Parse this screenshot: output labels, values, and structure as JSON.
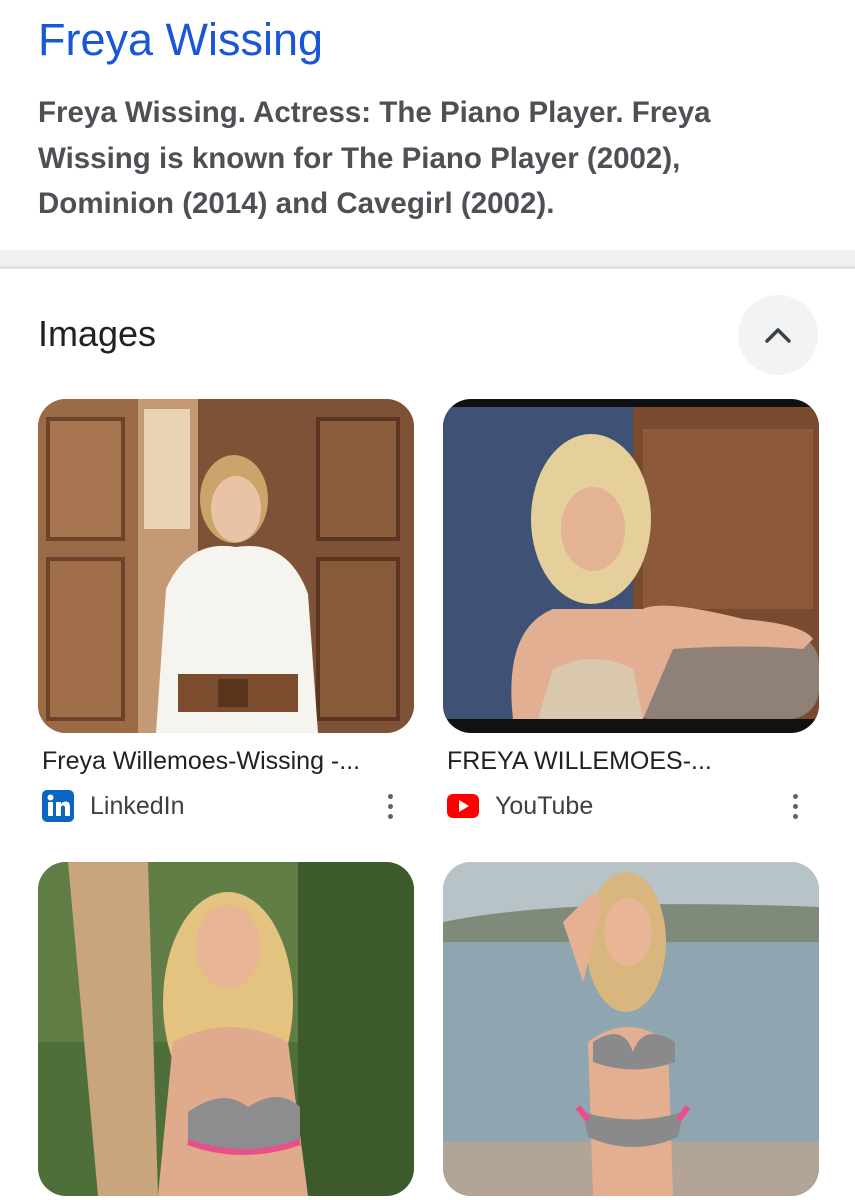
{
  "result": {
    "title": "Freya Wissing",
    "snippet": "Freya Wissing. Actress: The Piano Player. Freya Wissing is known for The Piano Player (2002), Dominion (2014) and Cavegirl (2002)."
  },
  "images_section": {
    "heading": "Images",
    "collapse_icon": "chevron-up-icon",
    "cards": [
      {
        "caption": "Freya Willemoes-Wissing -...",
        "source": "LinkedIn",
        "source_icon": "linkedin-icon",
        "source_color": "#0a66c2"
      },
      {
        "caption": "FREYA WILLEMOES-...",
        "source": "YouTube",
        "source_icon": "youtube-icon",
        "source_color": "#ff0000"
      },
      {
        "caption": "",
        "source": "",
        "source_icon": "",
        "source_color": ""
      },
      {
        "caption": "",
        "source": "",
        "source_icon": "",
        "source_color": ""
      }
    ]
  },
  "colors": {
    "link_blue": "#1a57d6",
    "snippet_gray": "#4d5156",
    "divider": "#eff0f2"
  }
}
